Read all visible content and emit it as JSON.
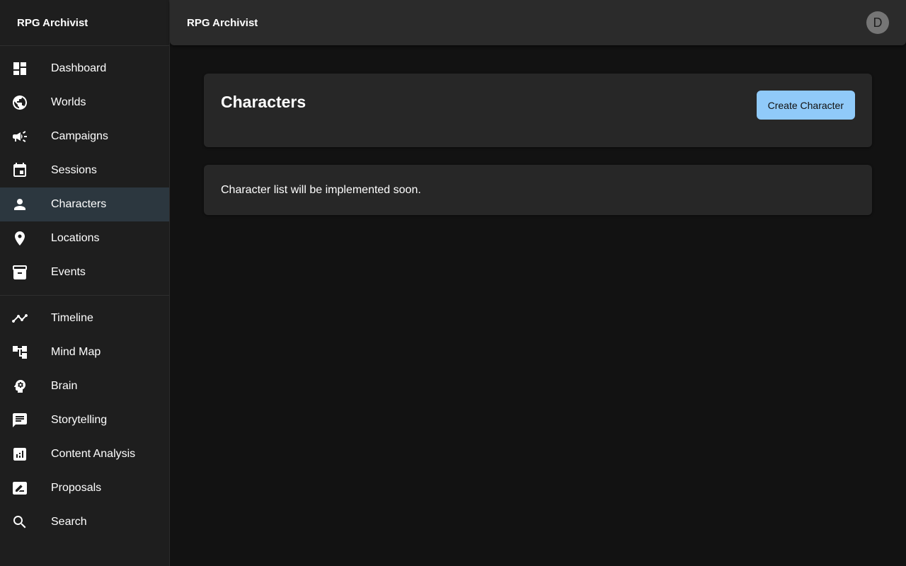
{
  "app": {
    "title": "RPG Archivist"
  },
  "sidebar": {
    "title": "RPG Archivist",
    "primary_items": [
      {
        "label": "Dashboard",
        "icon": "dashboard-icon"
      },
      {
        "label": "Worlds",
        "icon": "globe-icon"
      },
      {
        "label": "Campaigns",
        "icon": "megaphone-icon"
      },
      {
        "label": "Sessions",
        "icon": "calendar-icon"
      },
      {
        "label": "Characters",
        "icon": "person-icon",
        "active": true
      },
      {
        "label": "Locations",
        "icon": "location-pin-icon"
      },
      {
        "label": "Events",
        "icon": "archive-box-icon"
      }
    ],
    "secondary_items": [
      {
        "label": "Timeline",
        "icon": "timeline-icon"
      },
      {
        "label": "Mind Map",
        "icon": "account-tree-icon"
      },
      {
        "label": "Brain",
        "icon": "psychology-head-icon"
      },
      {
        "label": "Storytelling",
        "icon": "chat-message-icon"
      },
      {
        "label": "Content Analysis",
        "icon": "analytics-chart-icon"
      },
      {
        "label": "Proposals",
        "icon": "draw-icon"
      },
      {
        "label": "Search",
        "icon": "search-icon"
      }
    ]
  },
  "header": {
    "avatar_initial": "D"
  },
  "main": {
    "page_title": "Characters",
    "create_button_label": "Create Character",
    "placeholder_text": "Character list will be implemented soon."
  },
  "colors": {
    "background": "#121212",
    "sidebar": "#1e1e1e",
    "card": "#272727",
    "active_item": "#2c373f",
    "accent": "#90caf9"
  }
}
